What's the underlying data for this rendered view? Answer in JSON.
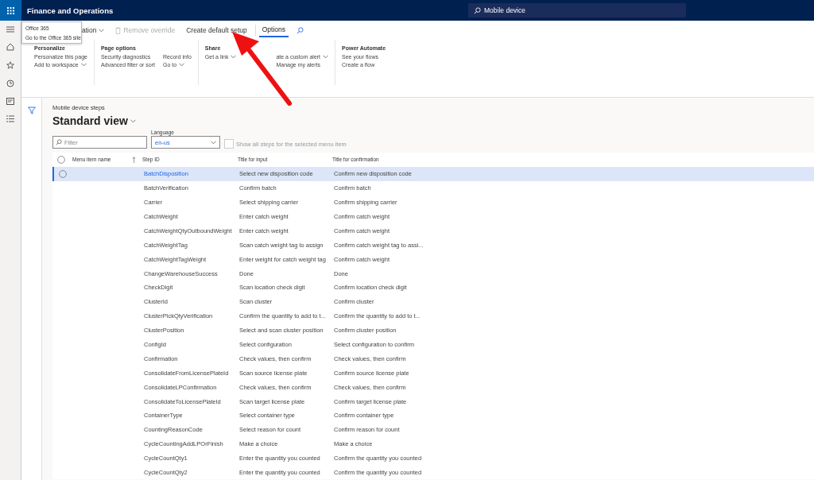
{
  "top_bar": {
    "title": "Finance and Operations",
    "search": {
      "value": "Mobile device"
    }
  },
  "office_popup": {
    "title": "Office 365",
    "link": "Go to the Office 365 site"
  },
  "action_bar": {
    "items": [
      {
        "label": "ation",
        "dropdown": true,
        "disabled": false
      },
      {
        "label": "Remove override",
        "dropdown": false,
        "disabled": true
      },
      {
        "label": "Create default setup",
        "dropdown": false,
        "disabled": false
      }
    ],
    "tabs": [
      {
        "label": "Options",
        "selected": true
      }
    ]
  },
  "ribbon": [
    {
      "title": "Personalize",
      "columns": [
        [
          {
            "label": "Personalize this page",
            "dropdown": false
          },
          {
            "label": "Add to workspace",
            "dropdown": true
          }
        ]
      ]
    },
    {
      "title": "Page options",
      "columns": [
        [
          {
            "label": "Security diagnostics",
            "dropdown": false
          },
          {
            "label": "Advanced filter or sort",
            "dropdown": false
          }
        ],
        [
          {
            "label": "Record info",
            "dropdown": false
          },
          {
            "label": "Go to",
            "dropdown": true
          }
        ]
      ]
    },
    {
      "title": "Share",
      "columns": [
        [
          {
            "label": "Get a link",
            "dropdown": true
          }
        ],
        [
          {
            "label": "ate a custom alert",
            "dropdown": true
          },
          {
            "label": "Manage my alerts",
            "dropdown": false
          }
        ]
      ]
    },
    {
      "title": "Power Automate",
      "columns": [
        [
          {
            "label": "See your flows",
            "dropdown": false
          },
          {
            "label": "Create a flow",
            "dropdown": false
          }
        ]
      ]
    }
  ],
  "page": {
    "caption": "Mobile device steps",
    "view": "Standard view",
    "filter": {
      "placeholder": "Filter"
    },
    "language": {
      "label": "Language",
      "value": "en-us"
    },
    "show_all": {
      "label": "Show all steps for the selected menu item",
      "checked": false
    }
  },
  "table": {
    "all_selected": false,
    "columns": [
      "Menu item name",
      "Step ID",
      "Title for input",
      "Title for confirmation"
    ],
    "rows": [
      {
        "selected": true,
        "cells": [
          "",
          "BatchDisposition",
          "Select new disposition code",
          "Confirm new disposition code"
        ]
      },
      {
        "selected": false,
        "cells": [
          "",
          "BatchVerification",
          "Confirm batch",
          "Confirm batch"
        ]
      },
      {
        "selected": false,
        "cells": [
          "",
          "Carrier",
          "Select shipping carrier",
          "Confirm shipping carrier"
        ]
      },
      {
        "selected": false,
        "cells": [
          "",
          "CatchWeight",
          "Enter catch weight",
          "Confirm catch weight"
        ]
      },
      {
        "selected": false,
        "cells": [
          "",
          "CatchWeightQtyOutboundWeight",
          "Enter catch weight",
          "Confirm catch weight"
        ]
      },
      {
        "selected": false,
        "cells": [
          "",
          "CatchWeightTag",
          "Scan catch weight tag to assign",
          "Confirm catch weight tag to assi..."
        ]
      },
      {
        "selected": false,
        "cells": [
          "",
          "CatchWeightTagWeight",
          "Enter weight for catch weight tag",
          "Confirm catch weight"
        ]
      },
      {
        "selected": false,
        "cells": [
          "",
          "ChangeWarehouseSuccess",
          "Done",
          "Done"
        ]
      },
      {
        "selected": false,
        "cells": [
          "",
          "CheckDigit",
          "Scan location check digit",
          "Confirm location check digit"
        ]
      },
      {
        "selected": false,
        "cells": [
          "",
          "ClusterId",
          "Scan cluster",
          "Confirm cluster"
        ]
      },
      {
        "selected": false,
        "cells": [
          "",
          "ClusterPickQtyVerification",
          "Confirm the quantity to add to t...",
          "Confirm the quantity to add to t..."
        ]
      },
      {
        "selected": false,
        "cells": [
          "",
          "ClusterPosition",
          "Select and scan cluster position",
          "Confirm cluster position"
        ]
      },
      {
        "selected": false,
        "cells": [
          "",
          "ConfigId",
          "Select configuration",
          "Select configuration to confirm"
        ]
      },
      {
        "selected": false,
        "cells": [
          "",
          "Confirmation",
          "Check values, then confirm",
          "Check values, then confirm"
        ]
      },
      {
        "selected": false,
        "cells": [
          "",
          "ConsolidateFromLicensePlateId",
          "Scan source license plate",
          "Confirm source license plate"
        ]
      },
      {
        "selected": false,
        "cells": [
          "",
          "ConsolidateLPConfirmation",
          "Check values, then confirm",
          "Check values, then confirm"
        ]
      },
      {
        "selected": false,
        "cells": [
          "",
          "ConsolidateToLicensePlateId",
          "Scan target license plate",
          "Confirm target license plate"
        ]
      },
      {
        "selected": false,
        "cells": [
          "",
          "ContainerType",
          "Select container type",
          "Confirm container type"
        ]
      },
      {
        "selected": false,
        "cells": [
          "",
          "CountingReasonCode",
          "Select reason for count",
          "Confirm reason for count"
        ]
      },
      {
        "selected": false,
        "cells": [
          "",
          "CycleCountingAddLPOrFinish",
          "Make a choice",
          "Make a choice"
        ]
      },
      {
        "selected": false,
        "cells": [
          "",
          "CycleCountQty1",
          "Enter the quantity you counted",
          "Confirm the quantity you counted"
        ]
      },
      {
        "selected": false,
        "cells": [
          "",
          "CycleCountQty2",
          "Enter the quantity you counted",
          "Confirm the quantity you counted"
        ]
      }
    ]
  }
}
